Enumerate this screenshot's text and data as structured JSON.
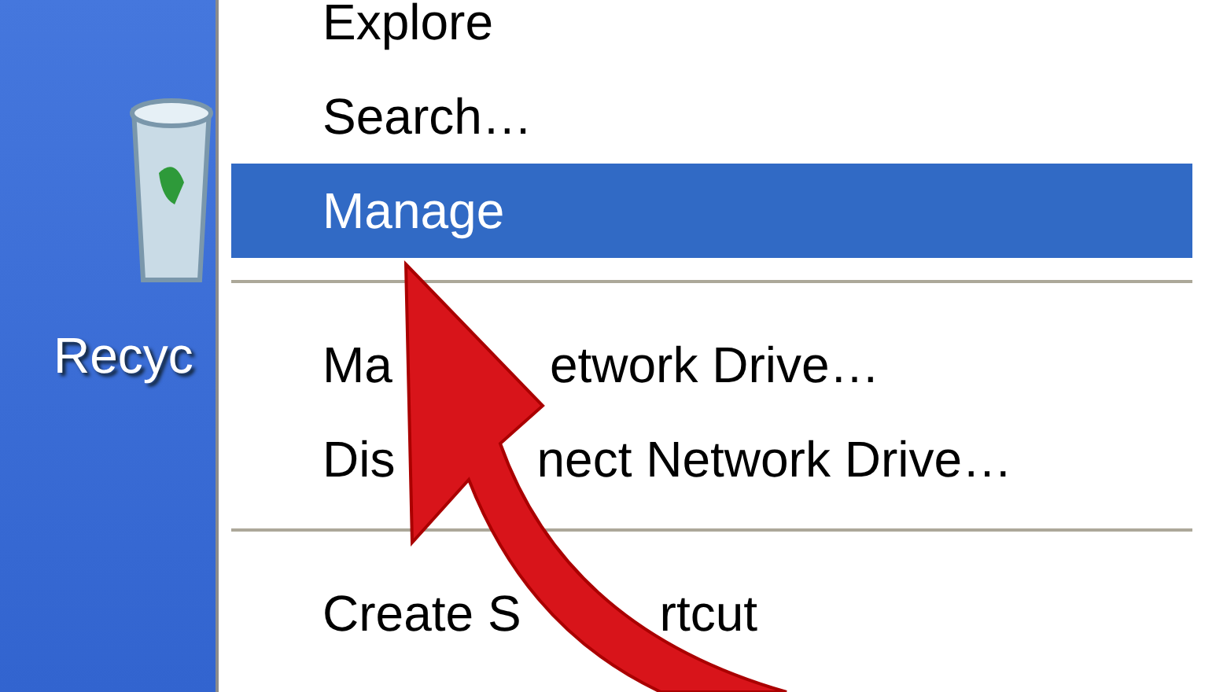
{
  "desktop": {
    "icon_label": "Recyc"
  },
  "menu": {
    "items": [
      {
        "kind": "item",
        "parts": [
          "Explore"
        ],
        "selected": false
      },
      {
        "kind": "item",
        "parts": [
          "Search…"
        ],
        "selected": false
      },
      {
        "kind": "item",
        "parts": [
          "Manage"
        ],
        "selected": true
      },
      {
        "kind": "separator"
      },
      {
        "kind": "item",
        "parts": [
          "Ma",
          "etwork Drive…"
        ],
        "selected": false
      },
      {
        "kind": "item",
        "parts": [
          "Dis",
          "nect Network Drive…"
        ],
        "selected": false
      },
      {
        "kind": "separator"
      },
      {
        "kind": "item",
        "parts": [
          "Create S",
          "rtcut"
        ],
        "selected": false
      }
    ]
  }
}
